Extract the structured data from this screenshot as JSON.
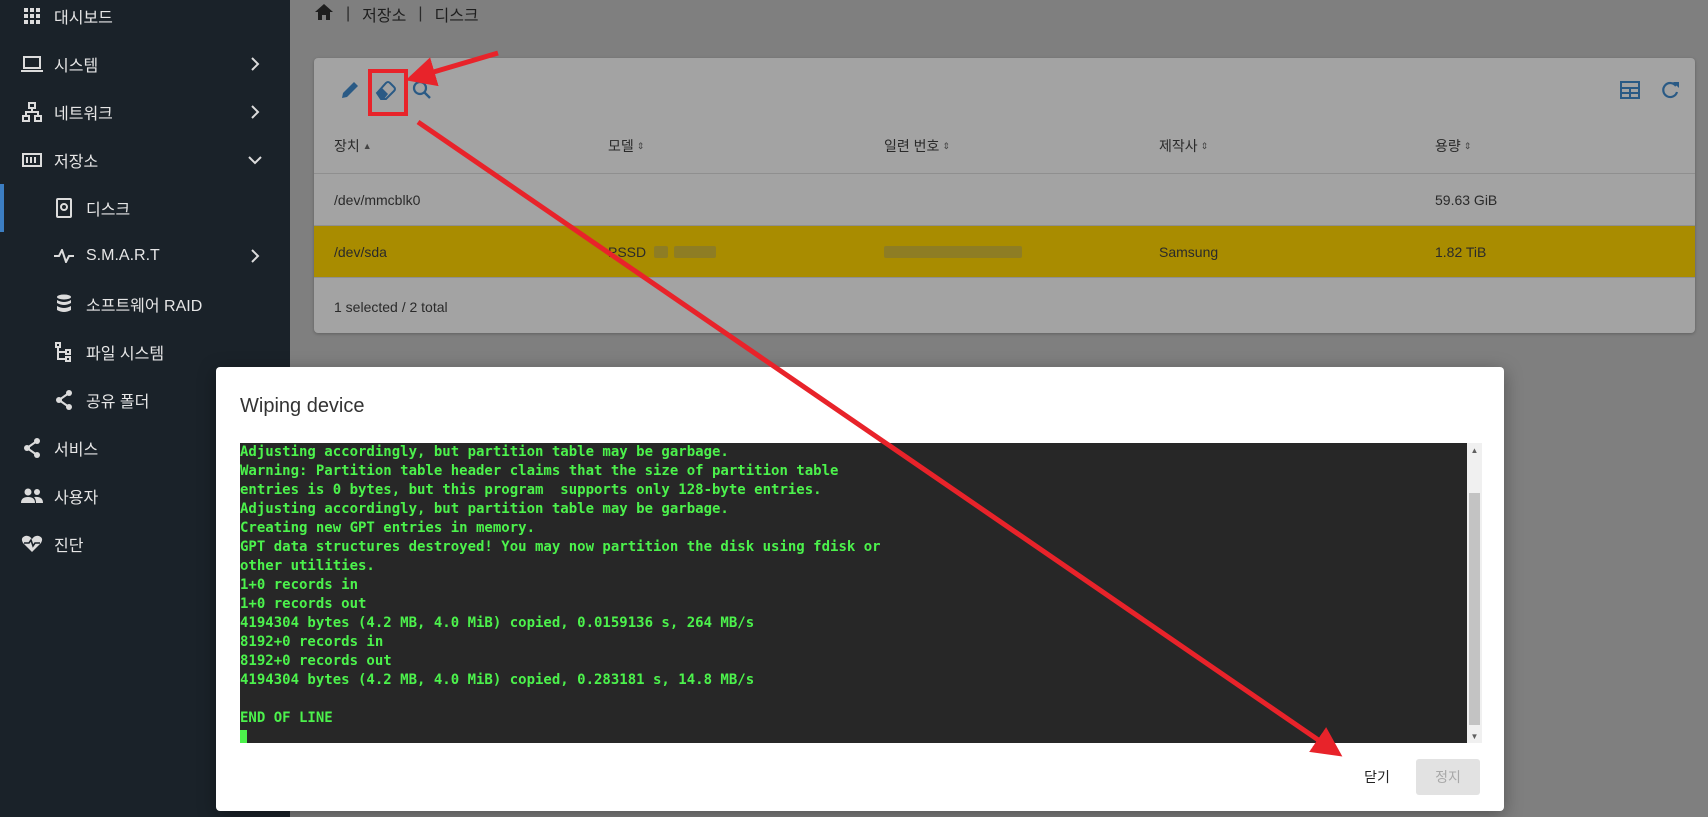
{
  "sidebar": {
    "items": [
      {
        "label": "대시보드",
        "icon": "apps-grid-icon"
      },
      {
        "label": "시스템",
        "icon": "laptop-icon"
      },
      {
        "label": "네트워크",
        "icon": "network-icon"
      },
      {
        "label": "저장소",
        "icon": "storage-icon"
      },
      {
        "label": "디스크",
        "icon": "disk-icon"
      },
      {
        "label": "S.M.A.R.T",
        "icon": "pulse-icon"
      },
      {
        "label": "소프트웨어 RAID",
        "icon": "database-icon"
      },
      {
        "label": "파일 시스템",
        "icon": "file-tree-icon"
      },
      {
        "label": "공유 폴더",
        "icon": "share-icon"
      },
      {
        "label": "서비스",
        "icon": "share-icon"
      },
      {
        "label": "사용자",
        "icon": "users-icon"
      },
      {
        "label": "진단",
        "icon": "heart-pulse-icon"
      }
    ]
  },
  "breadcrumb": {
    "home_icon": "home-icon",
    "level1": "저장소",
    "level2": "디스크"
  },
  "toolbar": {
    "edit_icon": "pencil-icon",
    "wipe_icon": "eraser-icon",
    "search_icon": "search-icon",
    "columns_icon": "table-icon",
    "refresh_icon": "refresh-icon"
  },
  "table": {
    "headers": [
      "장치",
      "모델",
      "일련 번호",
      "제작사",
      "용량"
    ],
    "rows": [
      {
        "device": "/dev/mmcblk0",
        "model": "",
        "serial": "",
        "vendor": "",
        "capacity": "59.63 GiB",
        "selected": false
      },
      {
        "device": "/dev/sda",
        "model": "PSSD",
        "serial": "",
        "vendor": "Samsung",
        "capacity": "1.82 TiB",
        "selected": true
      }
    ],
    "footer": "1 selected / 2 total"
  },
  "dialog": {
    "title": "Wiping device",
    "output_lines": [
      "Adjusting accordingly, but partition table may be garbage.",
      "Warning: Partition table header claims that the size of partition table",
      "entries is 0 bytes, but this program  supports only 128-byte entries.",
      "Adjusting accordingly, but partition table may be garbage.",
      "Creating new GPT entries in memory.",
      "GPT data structures destroyed! You may now partition the disk using fdisk or",
      "other utilities.",
      "1+0 records in",
      "1+0 records out",
      "4194304 bytes (4.2 MB, 4.0 MiB) copied, 0.0159136 s, 264 MB/s",
      "8192+0 records in",
      "8192+0 records out",
      "4194304 bytes (4.2 MB, 4.0 MiB) copied, 0.283181 s, 14.8 MB/s",
      "",
      "END OF LINE"
    ],
    "close_label": "닫기",
    "stop_label": "정지"
  },
  "colors": {
    "sidebar_bg": "#1a2229",
    "selected_row": "#a98c00",
    "terminal_text": "#4cf24c",
    "annotation": "#e8232a"
  }
}
